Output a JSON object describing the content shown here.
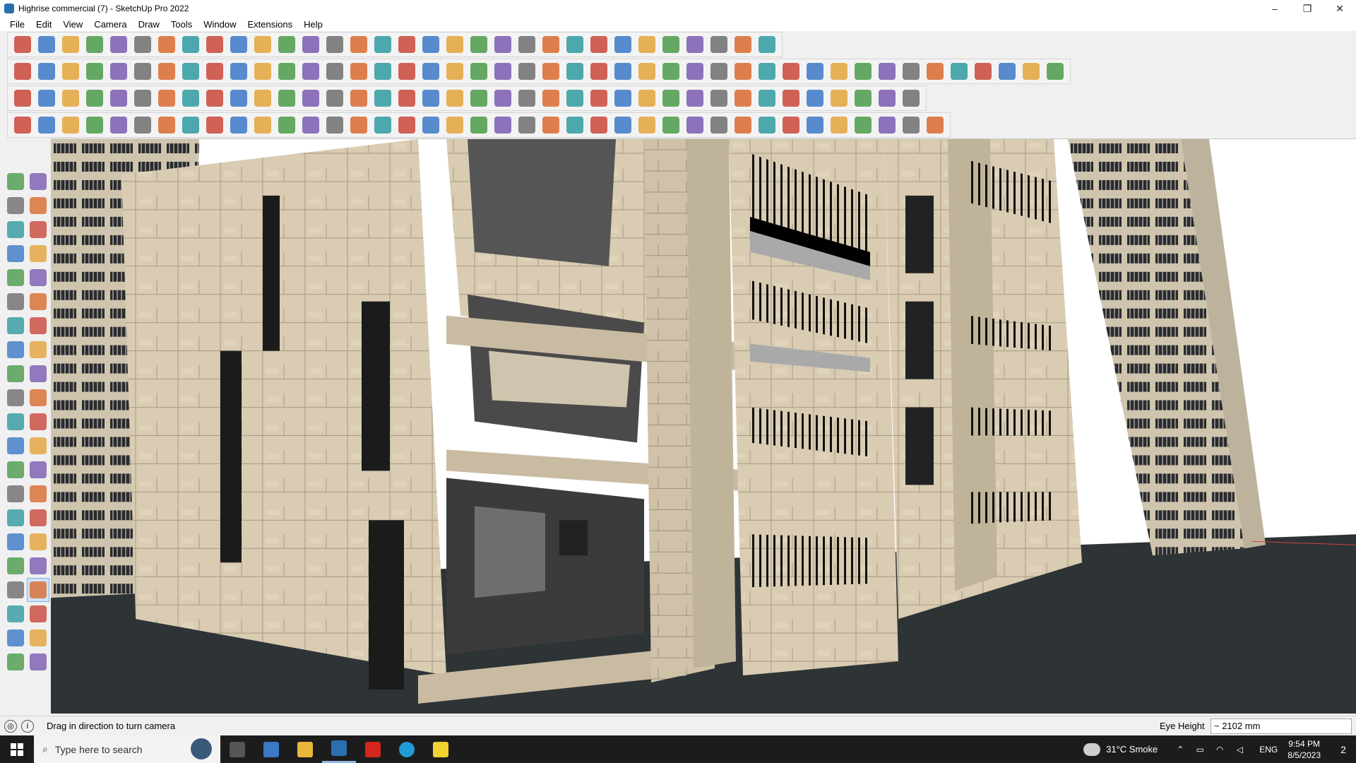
{
  "window": {
    "title": "Highrise commercial (7) - SketchUp Pro 2022",
    "minimize_glyph": "–",
    "restore_glyph": "❐",
    "close_glyph": "✕"
  },
  "menu": [
    "File",
    "Edit",
    "View",
    "Camera",
    "Draw",
    "Tools",
    "Window",
    "Extensions",
    "Help"
  ],
  "toolbars": {
    "row1": [
      "search-icon",
      "select-icon",
      "eraser-icon",
      "pencil-icon",
      "lasso-icon",
      "paint-icon",
      "push-pull-icon",
      "follow-me-icon",
      "move-icon",
      "rotate-icon",
      "scale-icon",
      "tape-icon",
      "text-icon",
      "paint-bucket-icon",
      "orbit-icon",
      "pan-icon",
      "zoom-icon",
      "zoom-extents-icon",
      "component-icon",
      "layers-icon",
      "shadow-icon",
      "styles-icon",
      "profile-icon",
      "export-icon",
      "import-icon",
      "up-icon",
      "down-icon",
      "axes-icon",
      "section-icon",
      "undo-icon",
      "redo-icon",
      "extension-icon"
    ],
    "row2": [
      "cube-icon",
      "iso-icon",
      "top-icon",
      "front-icon",
      "right-icon",
      "back-icon",
      "left-icon",
      "bottom-icon",
      "x-ray-icon",
      "wireframe-icon",
      "hidden-line-icon",
      "shaded-icon",
      "textured-icon",
      "mono-icon",
      "house-icon",
      "house2-icon",
      "house3-icon",
      "house4-icon",
      "house5-icon",
      "solid-icon",
      "union-icon",
      "subtract-icon",
      "trim-icon",
      "split-icon",
      "sandbox-icon",
      "circle-icon",
      "polygon-icon",
      "ellipse-icon",
      "parallelogram-icon",
      "arc-icon",
      "spline-icon",
      "offset-icon",
      "intersect-icon",
      "smooth-icon",
      "soften-icon",
      "edge-icon",
      "fillet-icon",
      "chamfer-icon",
      "roof-icon",
      "wall-icon",
      "window-icon",
      "door-icon",
      "stair-icon",
      "railing-icon"
    ],
    "row3": [
      "blue-box-icon",
      "blue-diamond-icon",
      "yellow-diamond-icon",
      "green-diamond-icon",
      "red-diamond-icon",
      "white-diamond-icon",
      "undo-arc-icon",
      "red-square-icon",
      "list-icon",
      "page-icon",
      "folder-icon",
      "chain-icon",
      "curve-icon",
      "dotted-curve-icon",
      "red-plus-icon",
      "green-plus-icon",
      "blue-cross-icon",
      "shape-icon",
      "flask-icon",
      "triangle-icon",
      "loop-icon",
      "knot-icon",
      "orbit-ring-icon",
      "sparkle-icon",
      "bucket-icon",
      "magnet-icon",
      "array-icon",
      "mirror-icon",
      "copy-icon",
      "tag-icon",
      "gear-icon",
      "frame-icon",
      "grid-icon",
      "orange-grid-icon",
      "yellow-grid-icon",
      "scatter-icon",
      "bezier-icon",
      "network-icon"
    ],
    "row4": [
      "path-icon",
      "dots-icon",
      "car-icon",
      "wire-icon",
      "gear2-icon",
      "cloth-icon",
      "hand-icon",
      "hat-icon",
      "sphere-icon",
      "helix-icon",
      "flare-icon",
      "corner-icon",
      "angle-icon",
      "line-icon",
      "arc2-icon",
      "rail-icon",
      "triangle2-icon",
      "fence-icon",
      "pergola-icon",
      "dome-icon",
      "shell-icon",
      "flag-icon",
      "stack-icon",
      "hatch-icon",
      "stripe-icon",
      "stripe2-icon",
      "truss-icon",
      "tile-icon",
      "wall2-icon",
      "column-icon",
      "slab-icon",
      "spiral-icon",
      "barcode-icon",
      "mesh-icon",
      "ring-icon",
      "slant-icon",
      "grille-icon",
      "mesh2-icon",
      "patch-icon"
    ]
  },
  "left_tools": [
    "select-arrow-icon",
    "orbit-swap-icon",
    "paint-bucket-icon",
    "eraser-icon",
    "component-tool-icon",
    "tape-measure-icon",
    "line-tool-icon",
    "freehand-icon",
    "rectangle-icon",
    "rotated-rectangle-icon",
    "circle-tool-icon",
    "polygon-tool-icon",
    "arc-tool-icon",
    "arc2-tool-icon",
    "pie-tool-icon",
    "3pt-arc-icon",
    "move-tool-icon",
    "push-pull-tool-icon",
    "rotate-tool-icon",
    "follow-me-tool-icon",
    "scale-tool-icon",
    "offset-tool-icon",
    "tape-tool-icon",
    "dimension-icon",
    "protractor-icon",
    "text-tool-icon",
    "axes-tool-icon",
    "3d-text-icon",
    "orbit-tool-icon",
    "pan-tool-icon",
    "zoom-tool-icon",
    "zoom-window-icon",
    "zoom-extents-tool-icon",
    "previous-view-icon",
    "position-camera-icon",
    "look-around-icon",
    "walk-icon",
    "section-plane-icon",
    "component-browser-icon",
    "layers-browser-icon",
    "scenes-icon",
    "shadows-icon"
  ],
  "status": {
    "hint": "Drag in direction to turn camera",
    "measure_label": "Eye Height",
    "measure_value": "~ 2102 mm"
  },
  "taskbar": {
    "search_placeholder": "Type here to search",
    "weather": "31°C  Smoke",
    "lang": "ENG",
    "time": "9:54 PM",
    "date": "8/5/2023",
    "notify_count": "2"
  },
  "colors": {
    "stone": "#d9ccb2",
    "stone_dark": "#b9ab91",
    "ground": "#2e3336",
    "glass": "#4e4e4e"
  }
}
